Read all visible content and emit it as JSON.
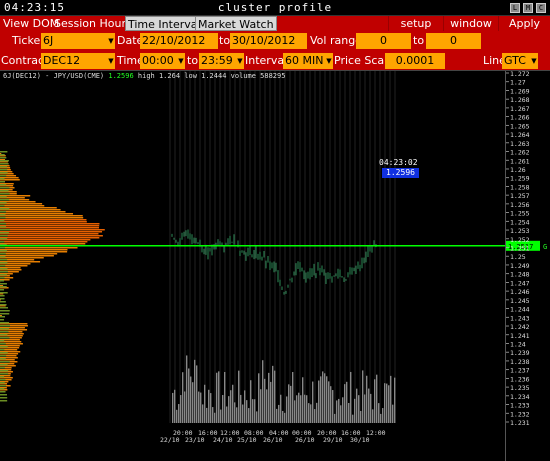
{
  "window": {
    "clock": "04:23:15",
    "title": "cluster profile",
    "buttons": [
      "L",
      "M",
      "C"
    ]
  },
  "menu": {
    "view_dom": "View DOM",
    "session_hours": "Session Hours",
    "time_interval": "Time Interval",
    "market_watch": "Market Watch",
    "setup": "setup",
    "window": "window",
    "apply": "Apply"
  },
  "toolbar": {
    "ticker_label": "Ticker",
    "ticker_value": "6J",
    "date_label": "Date",
    "date_from": "22/10/2012",
    "date_to_label": "to",
    "date_to": "30/10/2012",
    "vol_range_label": "Vol range",
    "vol_from": "0",
    "vol_to_label": "to",
    "vol_to": "0",
    "contract_label": "Contract",
    "contract_value": "DEC12",
    "time_label": "Time",
    "time_from": "00:00",
    "time_to_label": "to",
    "time_to": "23:59",
    "interval_label": "Interval",
    "interval_value": "60 MIN",
    "price_scale_label": "Price Scale",
    "price_scale_value": "0.0001",
    "line_label": "Line",
    "line_value": "GTC"
  },
  "chart": {
    "symbol": "6J(DEC12) - JPY/USD(CME)",
    "last": "1.2596",
    "high_text": "high 1.264",
    "low_text": "low 1.2444",
    "volume_text": "volume 588295",
    "timestamp": "04:23:02",
    "price_tag": "1.2596",
    "line_tag": "1.2517",
    "line_marker": "G",
    "colors": {
      "background": "#000000",
      "line": "#00ff00",
      "profile": "#ff8c00",
      "bars": "#2e8b57",
      "volume": "#888888",
      "price_tag": "#1030e0",
      "toolbar": "#c00000",
      "field": "#ffa500"
    }
  },
  "chart_data": {
    "type": "bar",
    "y_ticks": [
      "1.272",
      "1.27",
      "1.269",
      "1.268",
      "1.267",
      "1.266",
      "1.265",
      "1.264",
      "1.263",
      "1.262",
      "1.261",
      "1.26",
      "1.259",
      "1.258",
      "1.257",
      "1.256",
      "1.255",
      "1.254",
      "1.253",
      "1.252",
      "1.251",
      "1.25",
      "1.249",
      "1.248",
      "1.247",
      "1.246",
      "1.245",
      "1.244",
      "1.243",
      "1.242",
      "1.241",
      "1.24",
      "1.239",
      "1.238",
      "1.237",
      "1.236",
      "1.235",
      "1.234",
      "1.233",
      "1.232",
      "1.231"
    ],
    "x_ticks_time": [
      "20:00",
      "16:00",
      "12:00",
      "08:00",
      "04:00",
      "00:00",
      "20:00",
      "16:00",
      "12:00"
    ],
    "x_ticks_date": [
      "22/10",
      "23/10",
      "24/10",
      "25/10",
      "26/10",
      "26/10",
      "29/10",
      "30/10"
    ],
    "line_price": 1.2517,
    "last_price": 1.2596,
    "ylim": [
      1.231,
      1.272
    ]
  }
}
